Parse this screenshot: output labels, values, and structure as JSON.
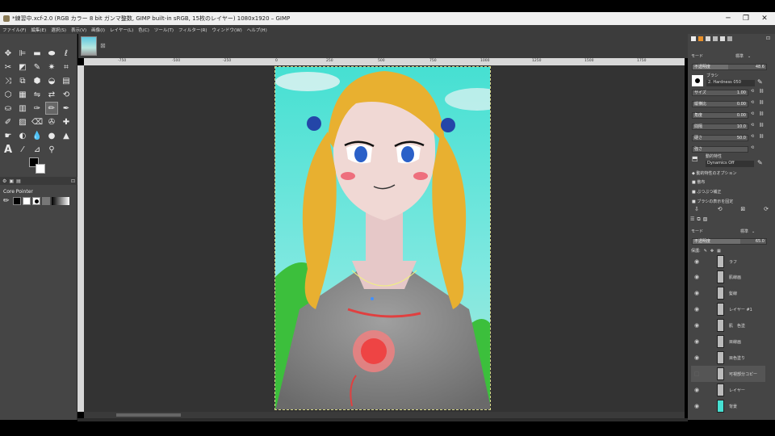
{
  "window": {
    "title": "*練習中.xcf-2.0 (RGB カラー 8 bit ガンマ整数, GIMP built-in sRGB, 15枚のレイヤー) 1080x1920 – GIMP",
    "minimize": "─",
    "maximize": "❐",
    "close": "✕"
  },
  "menu": [
    "ファイル(F)",
    "編集(E)",
    "選択(S)",
    "表示(V)",
    "画像(I)",
    "レイヤー(L)",
    "色(C)",
    "ツール(T)",
    "フィルター(R)",
    "ウィンドウ(W)",
    "ヘルプ(H)"
  ],
  "image_tab": {
    "close": "⊠"
  },
  "ruler_ticks": [
    "-750",
    "-500",
    "-250",
    "0",
    "250",
    "500",
    "750",
    "1000",
    "1250",
    "1500",
    "1750"
  ],
  "device_status": {
    "label": "Core Pointer"
  },
  "tool_options": {
    "mode_label": "モード",
    "mode_value": "標準",
    "opacity_label": "不透明度",
    "opacity_value": "48.6",
    "brush_label": "ブラシ",
    "brush_name": "2. Hardness 050",
    "size_label": "サイズ",
    "size_value": "1.00",
    "aspect_label": "縦横比",
    "aspect_value": "0.00",
    "angle_label": "角度",
    "angle_value": "0.00",
    "spacing_label": "間隔",
    "spacing_value": "10.0",
    "hardness_label": "硬さ",
    "hardness_value": "50.0",
    "force_label": "強さ",
    "dynamics_label": "動的特性",
    "dynamics_value": "Dynamics Off",
    "dynamics_options": "動的特性のオプション",
    "jitter": "散布",
    "smooth": "ぶつぶつ補正",
    "lock_brush": "ブラシの表示を固定"
  },
  "layers_panel": {
    "mode_label": "モード",
    "mode_value": "標準",
    "opacity_label": "不透明度",
    "opacity_value": "65.0",
    "lock_label": "保護:",
    "layers": [
      {
        "name": "ラフ",
        "visible": true,
        "selected": false
      },
      {
        "name": "肌線画",
        "visible": true,
        "selected": false
      },
      {
        "name": "髪線",
        "visible": true,
        "selected": false
      },
      {
        "name": "レイヤー #1",
        "visible": true,
        "selected": false
      },
      {
        "name": "肌　色塗",
        "visible": true,
        "selected": false
      },
      {
        "name": "目線画",
        "visible": true,
        "selected": false
      },
      {
        "name": "目色塗り",
        "visible": true,
        "selected": false
      },
      {
        "name": "可視部分コピー",
        "visible": false,
        "selected": true
      },
      {
        "name": "レイヤー",
        "visible": true,
        "selected": false
      },
      {
        "name": "背景",
        "visible": true,
        "selected": false
      }
    ]
  },
  "colors": {
    "ui_dark": "#454545",
    "canvas_bg": "#333333",
    "sky": "#46e0d2",
    "hair": "#e8b030",
    "eyes": "#2a60c8",
    "shirt": "#8a8a8a",
    "emblem": "#ee5555"
  }
}
